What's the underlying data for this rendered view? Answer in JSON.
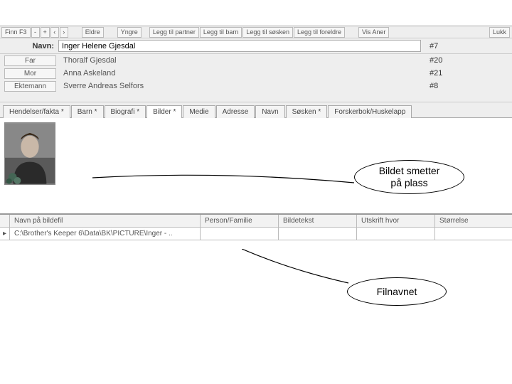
{
  "toolbar": {
    "find": "Finn F3",
    "minus": "-",
    "plus": "+",
    "prev": "‹",
    "next": "›",
    "older": "Eldre",
    "younger": "Yngre",
    "add_partner": "Legg til partner",
    "add_child": "Legg til barn",
    "add_sibling": "Legg til søsken",
    "add_parents": "Legg til foreldre",
    "view_ancestors": "Vis Aner",
    "close": "Lukk"
  },
  "name_row": {
    "label": "Navn:",
    "value": "Inger Helene Gjesdal",
    "id": "#7"
  },
  "relations": [
    {
      "role": "Far",
      "name": "Thoralf Gjesdal",
      "id": "#20"
    },
    {
      "role": "Mor",
      "name": "Anna Askeland",
      "id": "#21"
    },
    {
      "role": "Ektemann",
      "name": "Sverre Andreas Selfors",
      "id": "#8"
    }
  ],
  "tabs": [
    "Hendelser/fakta *",
    "Barn *",
    "Biografi *",
    "Bilder *",
    "Medie",
    "Adresse",
    "Navn",
    "Søsken *",
    "Forskerbok/Huskelapp"
  ],
  "grid": {
    "headers": [
      "Navn på bildefil",
      "Person/Familie",
      "Bildetekst",
      "Utskrift hvor",
      "Størrelse"
    ],
    "row": [
      "C:\\Brother's Keeper 6\\Data\\BK\\PICTURE\\Inger - ..",
      "",
      "",
      "",
      ""
    ]
  },
  "callouts": {
    "image_placed": "Bildet smetter\npå plass",
    "filename": "Filnavnet"
  },
  "row_marker": "▸"
}
